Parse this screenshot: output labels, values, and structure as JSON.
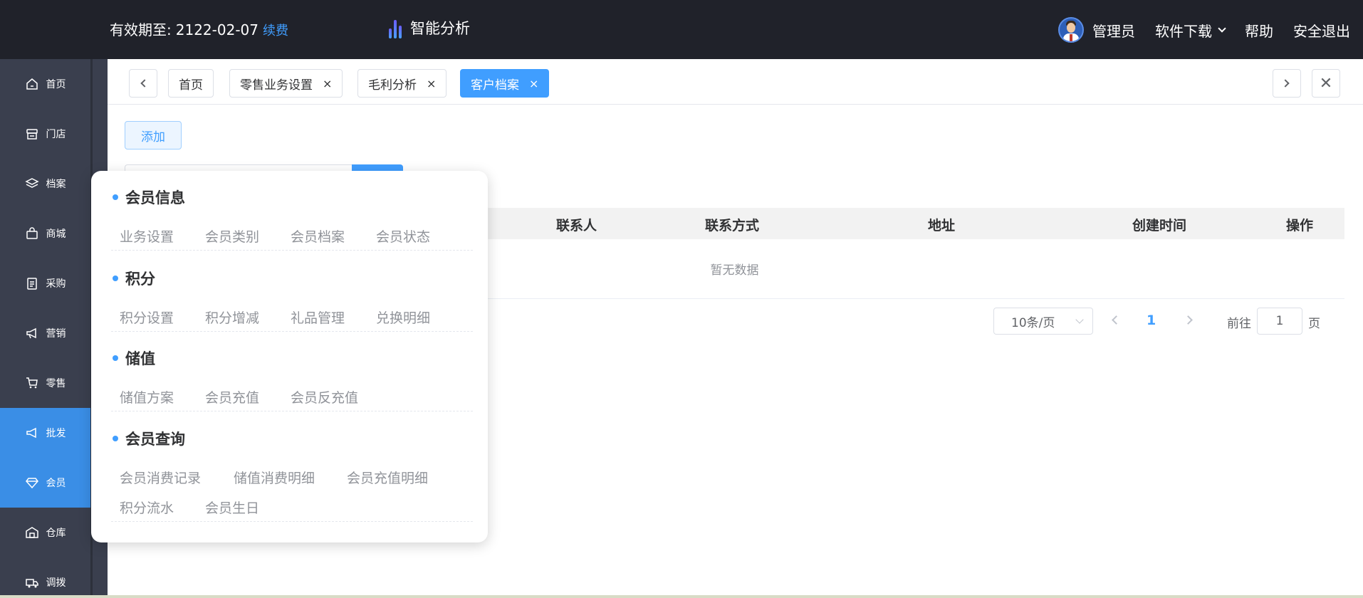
{
  "topbar": {
    "validity_label": "有效期至:",
    "validity_date": "2122-02-07",
    "renew_link": "续费",
    "brand_title": "智能分析",
    "user_name": "管理员",
    "download_label": "软件下载",
    "help_label": "帮助",
    "logout_label": "安全退出"
  },
  "sidebar": {
    "items": [
      {
        "label": "首页",
        "icon": "home-icon"
      },
      {
        "label": "门店",
        "icon": "store-icon"
      },
      {
        "label": "档案",
        "icon": "layers-icon"
      },
      {
        "label": "商城",
        "icon": "bag-icon"
      },
      {
        "label": "采购",
        "icon": "clipboard-icon"
      },
      {
        "label": "营销",
        "icon": "megaphone-icon"
      },
      {
        "label": "零售",
        "icon": "cart-icon"
      },
      {
        "label": "批发",
        "icon": "tag-icon"
      },
      {
        "label": "会员",
        "icon": "diamond-icon"
      },
      {
        "label": "仓库",
        "icon": "warehouse-icon"
      },
      {
        "label": "调拨",
        "icon": "truck-icon"
      }
    ]
  },
  "tabs": {
    "items": [
      {
        "label": "首页",
        "closable": false,
        "active": false
      },
      {
        "label": "零售业务设置",
        "closable": true,
        "active": false
      },
      {
        "label": "毛利分析",
        "closable": true,
        "active": false
      },
      {
        "label": "客户档案",
        "closable": true,
        "active": true
      }
    ],
    "close_symbol": "×"
  },
  "toolbar": {
    "add_label": "添加"
  },
  "table": {
    "columns": [
      "联系人",
      "联系方式",
      "地址",
      "创建时间",
      "操作"
    ],
    "empty_text": "暂无数据"
  },
  "pagination": {
    "page_size": "10条/页",
    "current_page": "1",
    "goto_label": "前往",
    "goto_value": "1",
    "page_suffix": "页"
  },
  "flyout": {
    "sections": [
      {
        "title": "会员信息",
        "items": [
          "业务设置",
          "会员类别",
          "会员档案",
          "会员状态"
        ]
      },
      {
        "title": "积分",
        "items": [
          "积分设置",
          "积分增减",
          "礼品管理",
          "兑换明细"
        ]
      },
      {
        "title": "储值",
        "items": [
          "储值方案",
          "会员充值",
          "会员反充值"
        ]
      },
      {
        "title": "会员查询",
        "items": [
          "会员消费记录",
          "储值消费明细",
          "会员充值明细",
          "积分流水",
          "会员生日"
        ]
      }
    ]
  },
  "colors": {
    "accent": "#409eff",
    "topbar_bg": "#20222a",
    "sidebar_bg": "#3a3f4e",
    "sidebar_active": "#3a8ee6"
  }
}
